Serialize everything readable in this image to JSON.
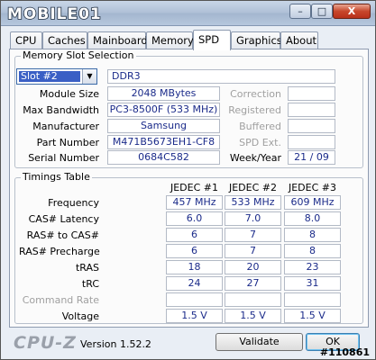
{
  "window": {
    "logo_text": "MOBILE01",
    "minimize": "–",
    "maximize": "□",
    "close": "X"
  },
  "tabs": [
    {
      "label": "CPU"
    },
    {
      "label": "Caches"
    },
    {
      "label": "Mainboard"
    },
    {
      "label": "Memory"
    },
    {
      "label": "SPD",
      "active": true
    },
    {
      "label": "Graphics"
    },
    {
      "label": "About"
    }
  ],
  "slot_section": {
    "title": "Memory Slot Selection",
    "selected_slot": "Slot #2",
    "memory_type": "DDR3",
    "labels": {
      "module_size": "Module Size",
      "max_bandwidth": "Max Bandwidth",
      "manufacturer": "Manufacturer",
      "part_number": "Part Number",
      "serial_number": "Serial Number",
      "correction": "Correction",
      "registered": "Registered",
      "buffered": "Buffered",
      "spd_ext": "SPD Ext.",
      "week_year": "Week/Year"
    },
    "values": {
      "module_size": "2048 MBytes",
      "max_bandwidth": "PC3-8500F (533 MHz)",
      "manufacturer": "Samsung",
      "part_number": "M471B5673EH1-CF8",
      "serial_number": "0684C582",
      "correction": "",
      "registered": "",
      "buffered": "",
      "spd_ext": "",
      "week_year": "21 / 09"
    }
  },
  "timings": {
    "title": "Timings Table",
    "columns": [
      "JEDEC #1",
      "JEDEC #2",
      "JEDEC #3"
    ],
    "rows": [
      {
        "label": "Frequency",
        "values": [
          "457 MHz",
          "533 MHz",
          "609 MHz"
        ]
      },
      {
        "label": "CAS# Latency",
        "values": [
          "6.0",
          "7.0",
          "8.0"
        ]
      },
      {
        "label": "RAS# to CAS#",
        "values": [
          "6",
          "7",
          "8"
        ]
      },
      {
        "label": "RAS# Precharge",
        "values": [
          "6",
          "7",
          "8"
        ]
      },
      {
        "label": "tRAS",
        "values": [
          "18",
          "20",
          "23"
        ]
      },
      {
        "label": "tRC",
        "values": [
          "24",
          "27",
          "31"
        ]
      },
      {
        "label": "Command Rate",
        "values": [
          "",
          "",
          ""
        ],
        "dim": true
      },
      {
        "label": "Voltage",
        "values": [
          "1.5 V",
          "1.5 V",
          "1.5 V"
        ]
      }
    ]
  },
  "footer": {
    "brand": "CPU-Z",
    "version": "Version 1.52.2",
    "validate_label": "Validate",
    "ok_label": "OK",
    "watermark": "#110861"
  },
  "colors": {
    "value_text": "#1b2b8a",
    "selection": "#3a5fc5"
  }
}
